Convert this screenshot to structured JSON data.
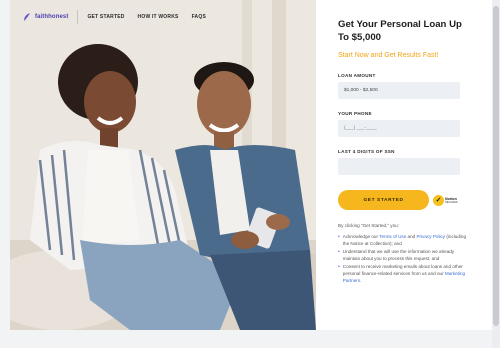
{
  "nav": {
    "logo_text": "faithhonest",
    "links": [
      "GET STARTED",
      "HOW IT WORKS",
      "FAQS"
    ]
  },
  "hero": {
    "image_alt": "couple-on-couch-photo"
  },
  "form": {
    "title": "Get Your Personal Loan Up To $5,000",
    "subtitle": "Start Now and Get Results Fast!",
    "loan_amount_label": "LOAN AMOUNT",
    "loan_amount_value": "$1,000 - $2,500",
    "phone_label": "YOUR PHONE",
    "phone_placeholder": "(___) ___-____",
    "ssn_label": "LAST 4 DIGITS OF SSN",
    "cta_label": "GET STARTED",
    "badge_text": "Norton",
    "badge_sub": "SECURED"
  },
  "consent": {
    "intro": "By clicking \"Get Started,\" you:",
    "item1_prefix": "Acknowledge our ",
    "item1_link1": "Terms of Use",
    "item1_mid": " and ",
    "item1_link2": "Privacy Policy",
    "item1_suffix": " (including the Notice at Collection); and",
    "item2": "Understand that we will use the information we already maintain about you to process this request; and",
    "item3_prefix": "Consent to receive marketing emails about loans and other personal finance-related services from us and our ",
    "item3_link": "Marketing Partners",
    "item3_suffix": "."
  },
  "colors": {
    "accent": "#f6b61d",
    "subtitle": "#f2a416",
    "link": "#3a6fd1",
    "logo": "#4b3fb0"
  }
}
